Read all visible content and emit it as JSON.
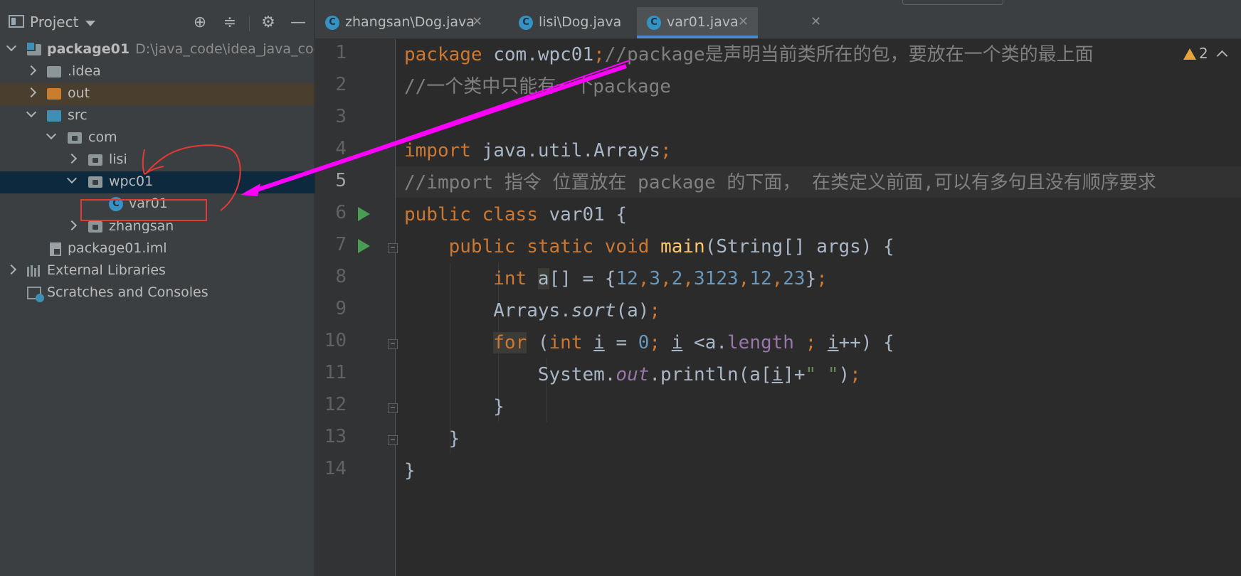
{
  "panel": {
    "title": "Project",
    "tree": [
      {
        "label": "package01",
        "path": "D:\\java_code\\idea_java_cod"
      },
      {
        "label": ".idea"
      },
      {
        "label": "out"
      },
      {
        "label": "src"
      },
      {
        "label": "com"
      },
      {
        "label": "lisi"
      },
      {
        "label": "wpc01"
      },
      {
        "label": "var01"
      },
      {
        "label": "zhangsan"
      },
      {
        "label": "package01.iml"
      },
      {
        "label": "External Libraries"
      },
      {
        "label": "Scratches and Consoles"
      }
    ]
  },
  "tabs": [
    {
      "label": "zhangsan\\Dog.java"
    },
    {
      "label": "lisi\\Dog.java"
    },
    {
      "label": "var01.java"
    }
  ],
  "inspection": {
    "count": "2"
  },
  "editor": {
    "line_numbers": [
      "1",
      "2",
      "3",
      "4",
      "5",
      "6",
      "7",
      "8",
      "9",
      "10",
      "11",
      "12",
      "13",
      "14"
    ],
    "l1": {
      "kw": "package",
      "rest": " com.wpc01",
      "semi": ";",
      "comment": "//package是声明当前类所在的包，要放在一个类的最上面"
    },
    "l2": {
      "comment": "//一个类中只能有一个package"
    },
    "l4": {
      "kw": "import",
      "rest": " java.util.Arrays",
      "semi": ";"
    },
    "l5": {
      "comment": "//import 指令 位置放在 package 的下面， 在类定义前面,可以有多句且没有顺序要求"
    },
    "l6": {
      "kw1": "public",
      "kw2": "class",
      "rest": " var01 {"
    },
    "l7": {
      "kw1": "public",
      "kw2": "static",
      "kw3": "void",
      "fn": "main",
      "rest": "(String[] args) {"
    },
    "l8": {
      "kw": "int",
      "var": "a",
      "pre": "[] = {",
      "n1": "12",
      "n2": "3",
      "n3": "2",
      "n4": "3123",
      "n5": "12",
      "n6": "23",
      "post": "}",
      "comma": ",",
      "semi": ";"
    },
    "l9": {
      "cls": "Arrays.",
      "mth": "sort",
      "rest": "(a)",
      "semi": ";"
    },
    "l10": {
      "kw": "for",
      "p1": " (",
      "kw2": "int",
      "v1": "i",
      "eq": " = ",
      "zero": "0",
      "semi": ";",
      "v2": "i",
      "lt": " <a.",
      "fld": "length",
      "v3": "i",
      "pp": "++) {"
    },
    "l11": {
      "cls": "System.",
      "fld": "out",
      "call": ".println(a[",
      "v": "i",
      "end": "]+",
      "str": "\" \"",
      "close": ")",
      "semi": ";"
    },
    "l12": {
      "text": "}"
    },
    "l13": {
      "text": "}"
    },
    "l14": {
      "text": "}"
    }
  },
  "colors": {
    "keyword": "#cc7832",
    "comment": "#808080",
    "number": "#6897bb",
    "annotation_red": "#e53935",
    "annotation_magenta": "#ff00ff"
  }
}
